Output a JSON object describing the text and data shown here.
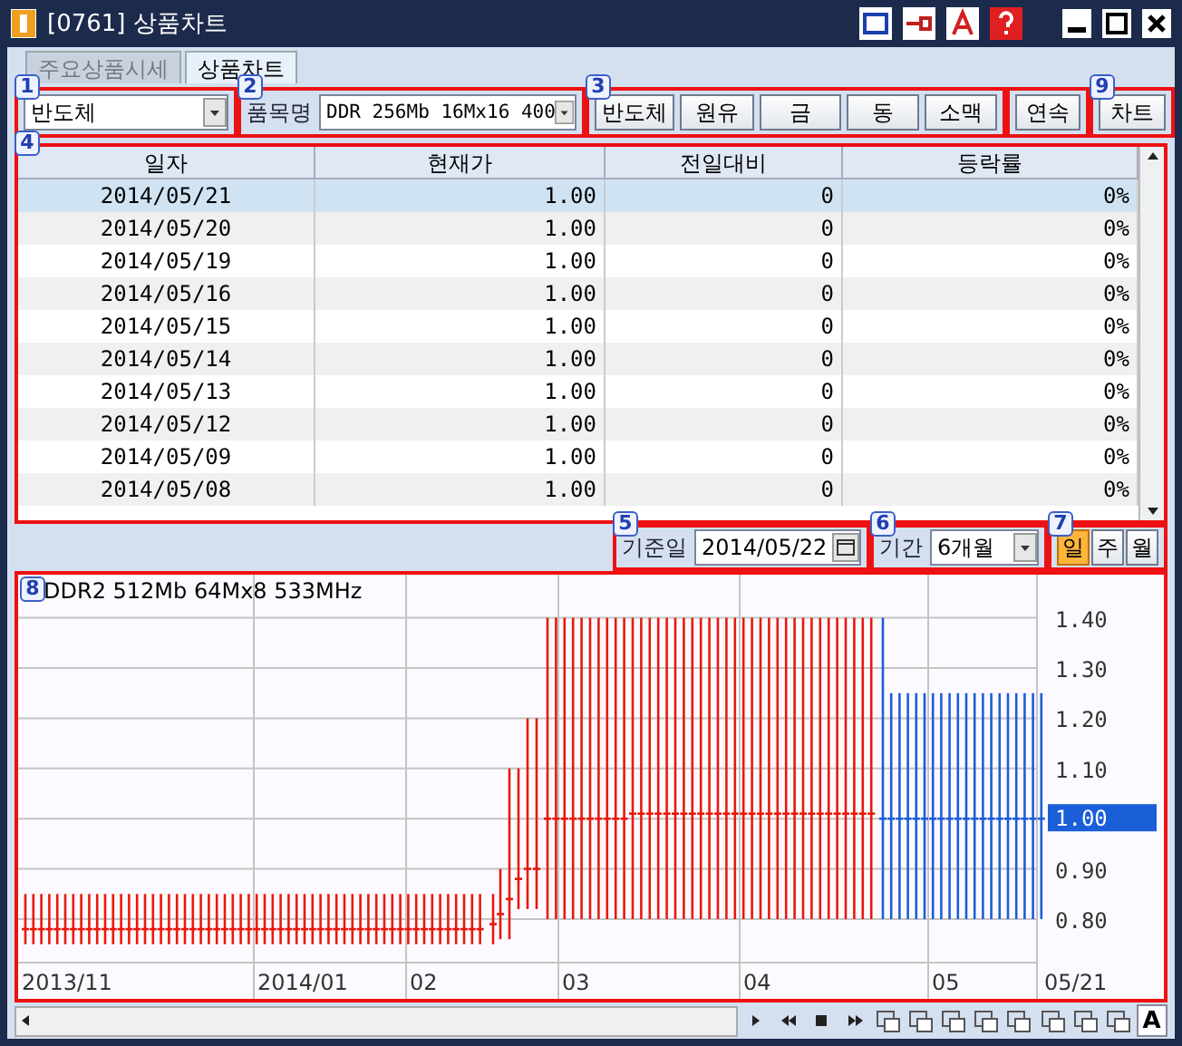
{
  "window": {
    "title": "[0761] 상품차트"
  },
  "tabs": [
    {
      "label": "주요상품시세",
      "selected": false
    },
    {
      "label": "상품차트",
      "selected": true
    }
  ],
  "toolbar": {
    "category": {
      "marker": "1",
      "value": "반도체"
    },
    "item": {
      "marker": "2",
      "label": "품목명",
      "value": "DDR 256Mb 16Mx16 400"
    },
    "quick": {
      "marker": "3",
      "buttons": [
        "반도체",
        "원유",
        "금",
        "동",
        "소맥"
      ]
    },
    "continuous": "연속",
    "chart_button": {
      "marker": "9",
      "label": "차트"
    }
  },
  "table": {
    "marker": "4",
    "columns": [
      "일자",
      "현재가",
      "전일대비",
      "등락률"
    ],
    "rows": [
      {
        "date": "2014/05/21",
        "price": "1.00",
        "change": "0",
        "rate": "0%",
        "selected": true
      },
      {
        "date": "2014/05/20",
        "price": "1.00",
        "change": "0",
        "rate": "0%",
        "selected": false
      },
      {
        "date": "2014/05/19",
        "price": "1.00",
        "change": "0",
        "rate": "0%",
        "selected": false
      },
      {
        "date": "2014/05/16",
        "price": "1.00",
        "change": "0",
        "rate": "0%",
        "selected": false
      },
      {
        "date": "2014/05/15",
        "price": "1.00",
        "change": "0",
        "rate": "0%",
        "selected": false
      },
      {
        "date": "2014/05/14",
        "price": "1.00",
        "change": "0",
        "rate": "0%",
        "selected": false
      },
      {
        "date": "2014/05/13",
        "price": "1.00",
        "change": "0",
        "rate": "0%",
        "selected": false
      },
      {
        "date": "2014/05/12",
        "price": "1.00",
        "change": "0",
        "rate": "0%",
        "selected": false
      },
      {
        "date": "2014/05/09",
        "price": "1.00",
        "change": "0",
        "rate": "0%",
        "selected": false
      },
      {
        "date": "2014/05/08",
        "price": "1.00",
        "change": "0",
        "rate": "0%",
        "selected": false
      }
    ]
  },
  "base_date": {
    "marker": "5",
    "label": "기준일",
    "value": "2014/05/22"
  },
  "period": {
    "marker": "6",
    "label": "기간",
    "value": "6개월"
  },
  "interval": {
    "marker": "7",
    "options": [
      {
        "label": "일",
        "selected": true
      },
      {
        "label": "주",
        "selected": false
      },
      {
        "label": "월",
        "selected": false
      }
    ]
  },
  "chart": {
    "marker": "8",
    "title": "DDR2 512Mb 64Mx8 533MHz",
    "y_labels": [
      "1.40",
      "1.30",
      "1.20",
      "1.10",
      "0.90",
      "0.80"
    ],
    "current": "1.00",
    "x_labels": [
      "2013/11",
      "2014/01",
      "02",
      "03",
      "04",
      "05",
      "05/21"
    ]
  },
  "bottom_bar": {
    "font_button": "A"
  }
}
